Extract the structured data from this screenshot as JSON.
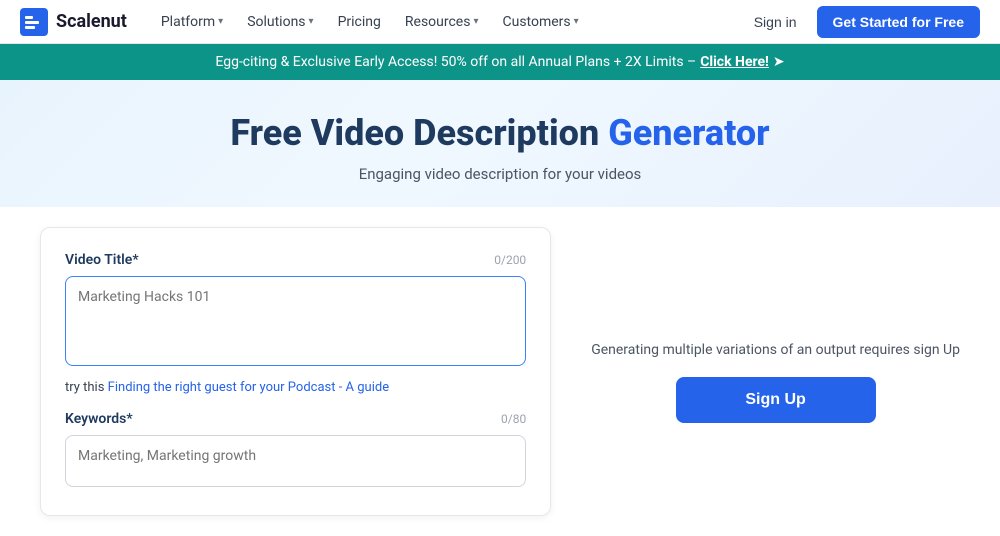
{
  "navbar": {
    "logo_text": "Scalenut",
    "nav_items": [
      {
        "label": "Platform",
        "has_dropdown": true
      },
      {
        "label": "Solutions",
        "has_dropdown": true
      },
      {
        "label": "Pricing",
        "has_dropdown": false
      },
      {
        "label": "Resources",
        "has_dropdown": true
      },
      {
        "label": "Customers",
        "has_dropdown": true
      }
    ],
    "sign_in_label": "Sign in",
    "get_started_label": "Get Started for Free"
  },
  "banner": {
    "text": "Egg-citing & Exclusive Early Access! 50% off on all Annual Plans + 2X Limits –",
    "link_text": "Click Here!",
    "arrow": "➤"
  },
  "hero": {
    "title_black": "Free Video Description",
    "title_blue": "Generator",
    "subtitle": "Engaging video description for your videos"
  },
  "form": {
    "video_title_label": "Video Title*",
    "video_title_char_count": "0/200",
    "video_title_placeholder": "Marketing Hacks 101",
    "try_this_prefix": "try this",
    "try_this_link": "Finding the right guest for your Podcast - A guide",
    "keywords_label": "Keywords*",
    "keywords_char_count": "0/80",
    "keywords_placeholder": "Marketing, Marketing growth"
  },
  "right_panel": {
    "hint_text": "Generating multiple variations of an output requires sign Up",
    "signup_label": "Sign Up"
  }
}
